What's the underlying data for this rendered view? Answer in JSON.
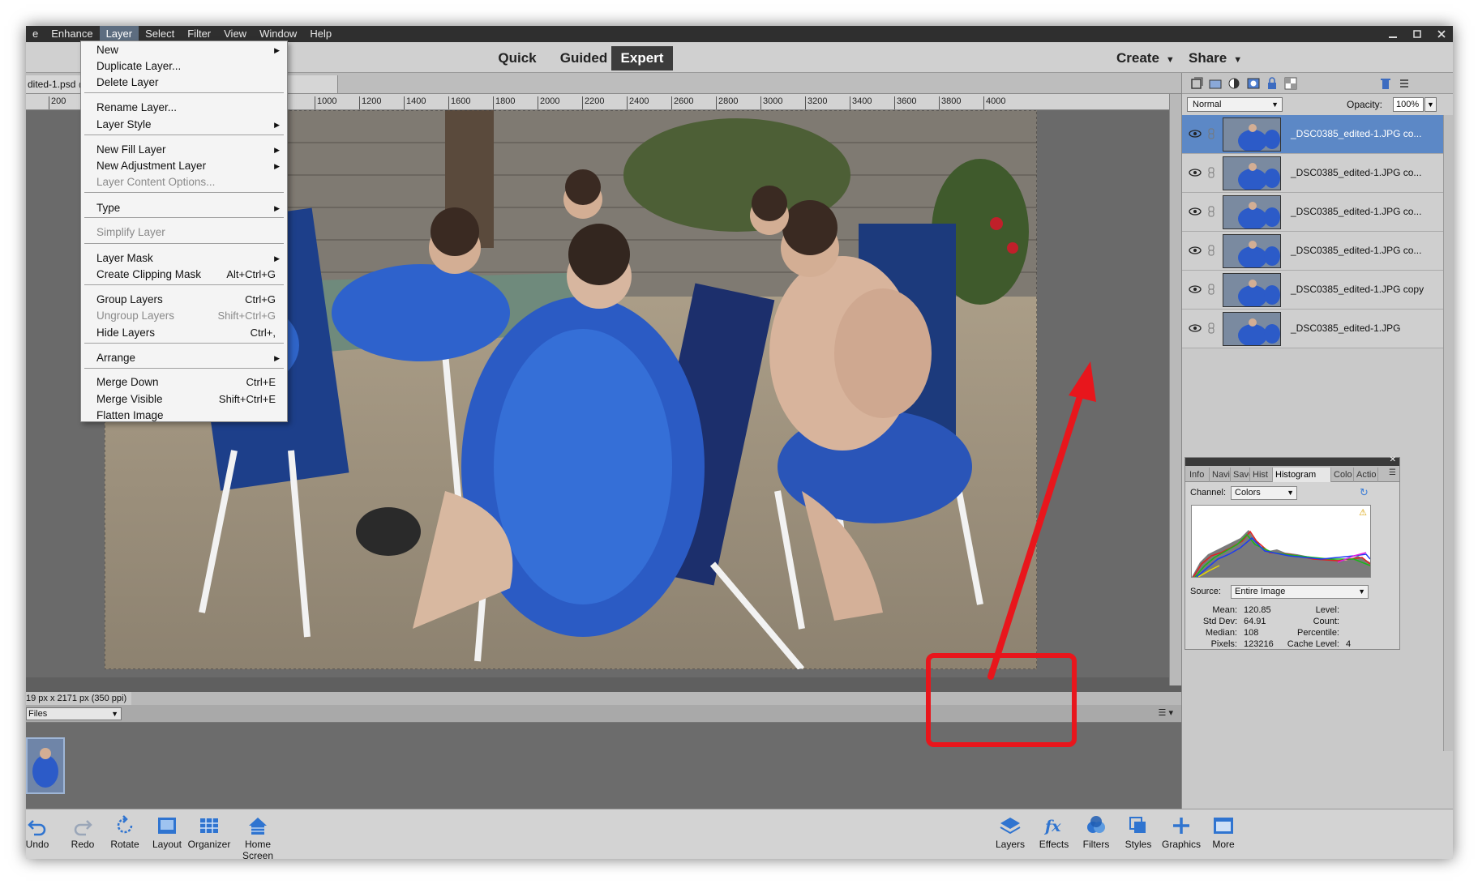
{
  "menubar": {
    "items": [
      "e",
      "Enhance",
      "Layer",
      "Select",
      "Filter",
      "View",
      "Window",
      "Help"
    ],
    "active": "Layer"
  },
  "modes": {
    "quick": "Quick",
    "guided": "Guided",
    "expert": "Expert",
    "active": "Expert"
  },
  "header_menus": {
    "create": "Create",
    "share": "Share"
  },
  "document": {
    "tab_title": "dited-1.psd @"
  },
  "ruler": {
    "ticks": [
      "200",
      "1000",
      "1200",
      "1400",
      "1600",
      "1800",
      "2000",
      "2200",
      "2400",
      "2600",
      "2800",
      "3000",
      "3200",
      "3400",
      "3600",
      "3800",
      "4000"
    ]
  },
  "status": {
    "size_text": "19 px x 2171 px (350 ppi)"
  },
  "project_bin": {
    "select_value": "Files"
  },
  "layer_menu": {
    "items": [
      {
        "label": "New",
        "submenu": true,
        "disabled": false
      },
      {
        "label": "Duplicate Layer...",
        "disabled": false
      },
      {
        "label": "Delete Layer",
        "disabled": false
      },
      {
        "label": "Rename Layer...",
        "disabled": false
      },
      {
        "label": "Layer Style",
        "submenu": true,
        "disabled": false
      },
      {
        "label": "New Fill Layer",
        "submenu": true,
        "disabled": false
      },
      {
        "label": "New Adjustment Layer",
        "submenu": true,
        "disabled": false
      },
      {
        "label": "Layer Content Options...",
        "disabled": true
      },
      {
        "label": "Type",
        "submenu": true,
        "disabled": false
      },
      {
        "label": "Simplify Layer",
        "disabled": true
      },
      {
        "label": "Layer Mask",
        "submenu": true,
        "disabled": false
      },
      {
        "label": "Create Clipping Mask",
        "shortcut": "Alt+Ctrl+G",
        "disabled": false
      },
      {
        "label": "Group Layers",
        "shortcut": "Ctrl+G",
        "disabled": false
      },
      {
        "label": "Ungroup Layers",
        "shortcut": "Shift+Ctrl+G",
        "disabled": true
      },
      {
        "label": "Hide Layers",
        "shortcut": "Ctrl+,",
        "disabled": false
      },
      {
        "label": "Arrange",
        "submenu": true,
        "disabled": false
      },
      {
        "label": "Merge Down",
        "shortcut": "Ctrl+E",
        "disabled": false
      },
      {
        "label": "Merge Visible",
        "shortcut": "Shift+Ctrl+E",
        "disabled": false
      },
      {
        "label": "Flatten Image",
        "disabled": false
      }
    ]
  },
  "layers_panel": {
    "blend_mode": "Normal",
    "opacity_label": "Opacity:",
    "opacity_value": "100%",
    "layers": [
      {
        "name": "_DSC0385_edited-1.JPG co...",
        "selected": true
      },
      {
        "name": "_DSC0385_edited-1.JPG co...",
        "selected": false
      },
      {
        "name": "_DSC0385_edited-1.JPG co...",
        "selected": false
      },
      {
        "name": "_DSC0385_edited-1.JPG co...",
        "selected": false
      },
      {
        "name": "_DSC0385_edited-1.JPG copy",
        "selected": false
      },
      {
        "name": "_DSC0385_edited-1.JPG",
        "selected": false
      }
    ]
  },
  "histogram_panel": {
    "tabs": [
      "Info",
      "Navi",
      "Save",
      "Hist",
      "Histogram",
      "Colo",
      "Actio"
    ],
    "active_tab": "Histogram",
    "channel_label": "Channel:",
    "channel_value": "Colors",
    "source_label": "Source:",
    "source_value": "Entire Image",
    "stats_left": [
      {
        "label": "Mean:",
        "value": "120.85"
      },
      {
        "label": "Std Dev:",
        "value": "64.91"
      },
      {
        "label": "Median:",
        "value": "108"
      },
      {
        "label": "Pixels:",
        "value": "123216"
      }
    ],
    "stats_right": [
      {
        "label": "Level:",
        "value": ""
      },
      {
        "label": "Count:",
        "value": ""
      },
      {
        "label": "Percentile:",
        "value": ""
      },
      {
        "label": "Cache Level:",
        "value": "4"
      }
    ]
  },
  "taskbar": {
    "left": [
      "Undo",
      "Redo",
      "Rotate",
      "Layout",
      "Organizer",
      "Home Screen"
    ],
    "right": [
      "Layers",
      "Effects",
      "Filters",
      "Styles",
      "Graphics",
      "More"
    ]
  },
  "colors": {
    "annotation_red": "#e8161c",
    "selection_blue": "#5c88c6"
  }
}
